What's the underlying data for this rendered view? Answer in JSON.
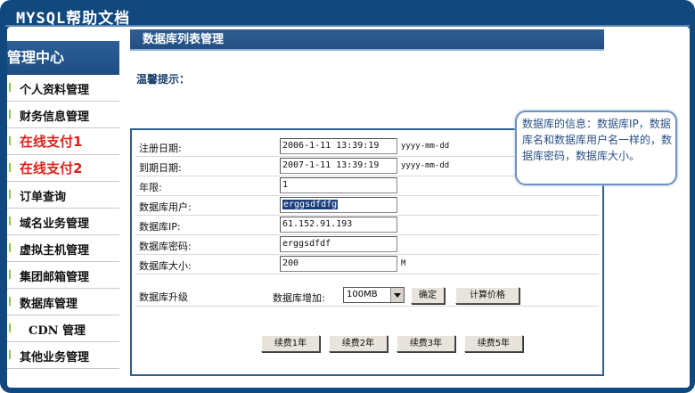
{
  "app": {
    "title": "MYSQL帮助文档"
  },
  "sidebar": {
    "header": "管理中心",
    "items": [
      {
        "label": "个人资料管理",
        "style": "normal"
      },
      {
        "label": "财务信息管理",
        "style": "normal"
      },
      {
        "label": "在线支付1",
        "style": "red"
      },
      {
        "label": "在线支付2",
        "style": "red"
      },
      {
        "label": "订单查询",
        "style": "normal"
      },
      {
        "label": "域名业务管理",
        "style": "normal"
      },
      {
        "label": "虚拟主机管理",
        "style": "normal"
      },
      {
        "label": "集团邮箱管理",
        "style": "normal"
      },
      {
        "label": "数据库管理",
        "style": "normal"
      },
      {
        "label": "CDN 管理",
        "style": "cdn"
      },
      {
        "label": "其他业务管理",
        "style": "normal"
      }
    ]
  },
  "main": {
    "header": "数据库列表管理",
    "tip_label": "温馨提示："
  },
  "form": {
    "register_date": {
      "label": "注册日期:",
      "value": "2006-1-11 13:39:19",
      "hint": "yyyy-mm-dd"
    },
    "expire_date": {
      "label": "到期日期:",
      "value": "2007-1-11 13:39:19",
      "hint": "yyyy-mm-dd"
    },
    "years": {
      "label": "年限:",
      "value": "1"
    },
    "db_user": {
      "label": "数据库用户:",
      "value": "erggsdfdfg"
    },
    "db_ip": {
      "label": "数据库IP:",
      "value": "61.152.91.193"
    },
    "db_password": {
      "label": "数据库密码:",
      "value": "erggsdfdf"
    },
    "db_size": {
      "label": "数据库大小:",
      "value": "200",
      "unit": "M"
    },
    "upgrade": {
      "label": "数据库升级",
      "add_label": "数据库增加:",
      "selected_option": "100MB",
      "confirm_label": "确定",
      "calc_label": "计算价格"
    },
    "renew_buttons": [
      "续费1年",
      "续费2年",
      "续费3年",
      "续费5年"
    ]
  },
  "bubble": {
    "text": "数据库的信息：数据库IP，数据库名和数据库用户名一样的，数据库密码，数据库大小。"
  },
  "colors": {
    "frame": "#11497e",
    "header": "#2f5f95",
    "red_item": "#e0201c",
    "bubble_border": "#6f93bf",
    "bubble_text": "#2b4f86"
  }
}
